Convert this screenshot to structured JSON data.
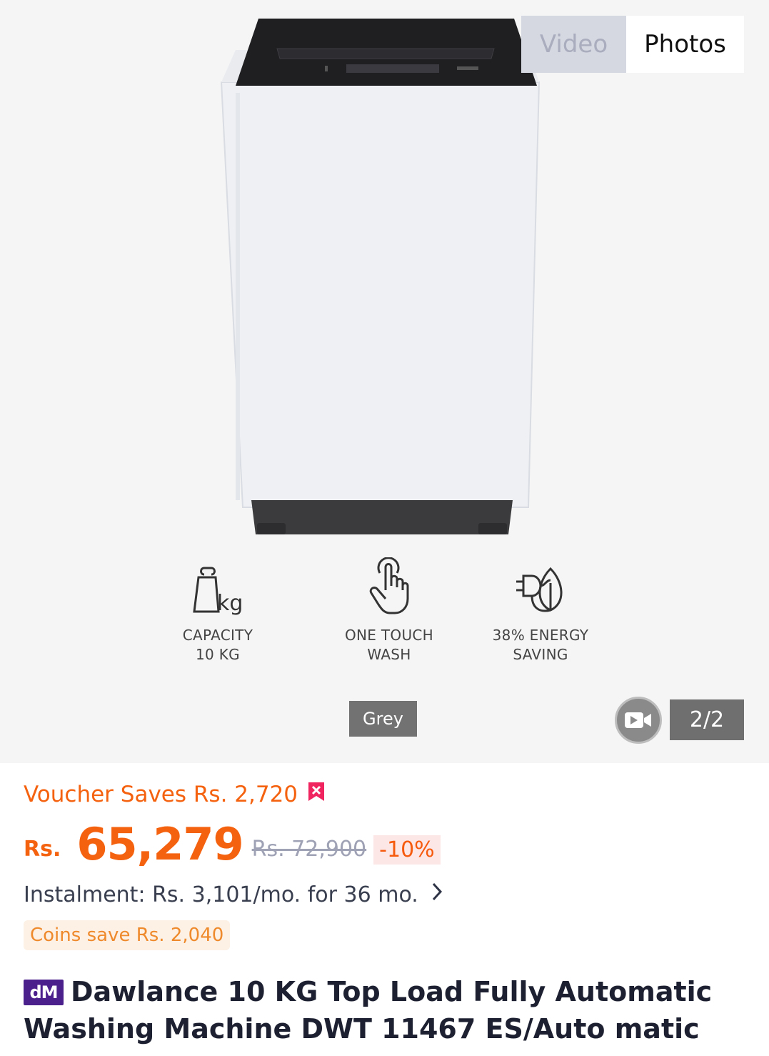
{
  "gallery": {
    "tabs": [
      {
        "label": "Video",
        "active": false
      },
      {
        "label": "Photos",
        "active": true
      }
    ],
    "features": [
      {
        "icon": "weight-kg-icon",
        "label": "CAPACITY\n10 KG"
      },
      {
        "icon": "touch-hand-icon",
        "label": "ONE TOUCH\nWASH"
      },
      {
        "icon": "plug-leaf-icon",
        "label": "38% ENERGY\nSAVING"
      }
    ],
    "color_label": "Grey",
    "page_counter": "2/2"
  },
  "product": {
    "voucher_text": "Voucher Saves Rs. 2,720",
    "currency": "Rs.",
    "price": "65,279",
    "original_price": "Rs. 72,900",
    "discount": "-10%",
    "instalment": "Instalment: Rs. 3,101/mo. for 36 mo.",
    "coins_text": "Coins save Rs. 2,040",
    "brand_badge": "dM",
    "title": "Dawlance 10 KG Top Load Fully Automatic Washing Machine DWT 11467 ES/Auto matic"
  },
  "colors": {
    "accent": "#f5620f",
    "voucher_icon": "#f0245f",
    "brand_badge": "#4b1f8c"
  }
}
